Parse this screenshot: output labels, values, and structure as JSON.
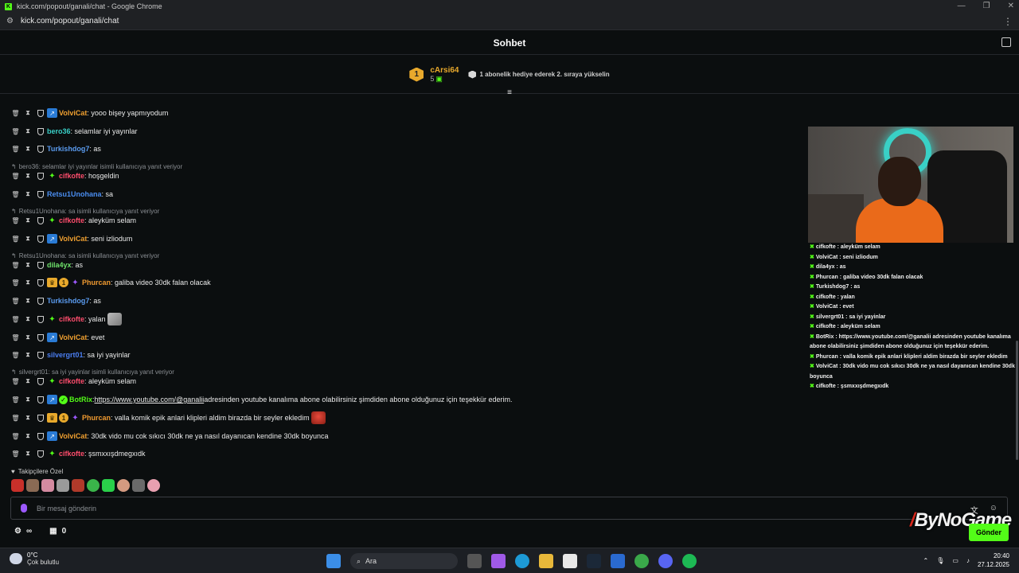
{
  "browser": {
    "window_title": "kick.com/popout/ganali/chat - Google Chrome",
    "url": "kick.com/popout/ganali/chat"
  },
  "chat_header": {
    "title": "Sohbet"
  },
  "pinned": {
    "rank": "1",
    "username": "cArsi64",
    "count": "5",
    "info": "1 abonelik hediye ederek 2. sıraya yükselin"
  },
  "messages": [
    {
      "user": "VolviCat",
      "color": "#f0a030",
      "text": ": yooo bişey yapmıyodum"
    },
    {
      "user": "bero36",
      "color": "#3ad0c8",
      "text": ": selamlar iyi yayınlar"
    },
    {
      "user": "Turkishdog7",
      "color": "#5b9cf0",
      "text": ": as"
    },
    {
      "reply": "bero36: selamlar iyi yayınlar isimli kullanıcıya yanıt veriyor"
    },
    {
      "user": "cifkofte",
      "color": "#ff4d6d",
      "text": ": hoşgeldin"
    },
    {
      "user": "Retsu1Unohana",
      "color": "#4a8df0",
      "text": ": sa"
    },
    {
      "reply": "Retsu1Unohana: sa isimli kullanıcıya yanıt veriyor"
    },
    {
      "user": "cifkofte",
      "color": "#ff4d6d",
      "text": ": aleyküm selam"
    },
    {
      "user": "VolviCat",
      "color": "#f0a030",
      "text": ": seni izliodum"
    },
    {
      "reply": "Retsu1Unohana: sa isimli kullanıcıya yanıt veriyor"
    },
    {
      "user": "dila4yx",
      "color": "#6ee06a",
      "text": ": as"
    },
    {
      "user": "Phurcan",
      "color": "#f09a30",
      "text": ": galiba video 30dk falan olacak"
    },
    {
      "user": "Turkishdog7",
      "color": "#5b9cf0",
      "text": ": as"
    },
    {
      "user": "cifkofte",
      "color": "#ff4d6d",
      "text": ": yalan"
    },
    {
      "user": "VolviCat",
      "color": "#f0a030",
      "text": ": evet"
    },
    {
      "user": "silvergrt01",
      "color": "#4a7df0",
      "text": ": sa iyi yayinlar"
    },
    {
      "reply": "silvergrt01: sa iyi yayinlar isimli kullanıcıya yanıt veriyor"
    },
    {
      "user": "cifkofte",
      "color": "#ff4d6d",
      "text": ": aleyküm selam"
    },
    {
      "user": "BotRix",
      "color": "#53fc18",
      "text": ": ",
      "link": "https://www.youtube.com/@ganalii",
      "text2": " adresinden youtube kanalıma abone olabilirsiniz şimdiden abone olduğunuz için teşekkür ederim."
    },
    {
      "user": "Phurcan",
      "color": "#f09a30",
      "text": ": valla komik epik anlari klipleri aldim birazda bir seyler ekledim"
    },
    {
      "user": "VolviCat",
      "color": "#f0a030",
      "text": ": 30dk vido mu cok sıkıcı 30dk ne ya nasıl dayanıcan kendine 30dk boyunca"
    },
    {
      "user": "cifkofte",
      "color": "#ff4d6d",
      "text": ": şsmxxışdmegxıdk"
    }
  ],
  "followers_label": "Takipçilere Özel",
  "input": {
    "placeholder": "Bir mesaj gönderin"
  },
  "bottom": {
    "infinity": "∞",
    "count": "0"
  },
  "send_label": "Gönder",
  "watermark": "ByNoGame",
  "overlay_chat": [
    "cifkofte : aleyküm selam",
    "VolviCat : seni izliodum",
    "dila4yx : as",
    "Phurcan : galiba video 30dk falan olacak",
    "Turkishdog7 : as",
    "cifkofte : yalan",
    "VolviCat : evet",
    "silvergrt01 : sa iyi yayinlar",
    "cifkofte : aleyküm selam",
    "BotRix : https://www.youtube.com/@ganalii adresinden youtube kanalıma abone olabilirsiniz şimdiden abone olduğunuz için teşekkür ederim.",
    "Phurcan : valla komik epik anlari klipleri aldim birazda bir seyler ekledim",
    "VolviCat : 30dk vido mu cok sıkıcı 30dk ne ya nasıl dayanıcan kendine 30dk boyunca",
    "cifkofte : şsmxxışdmegxıdk"
  ],
  "taskbar": {
    "temp": "0°C",
    "weather": "Çok bulutlu",
    "search": "Ara",
    "time": "20:40",
    "date": "27.12.2025"
  }
}
